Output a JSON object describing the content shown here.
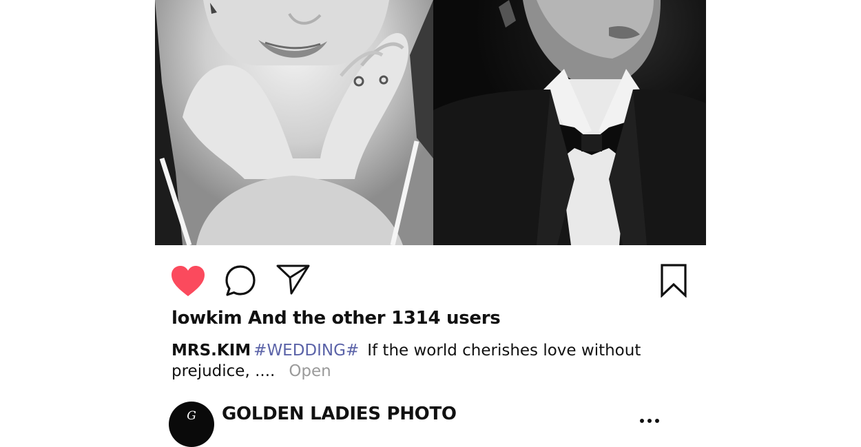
{
  "post": {
    "photos": [
      {
        "subject": "bride"
      },
      {
        "subject": "groom"
      }
    ],
    "actions": {
      "like_icon": "heart-icon",
      "liked": true,
      "like_color": "#fb4a5d",
      "comment_icon": "comment-bubble-icon",
      "share_icon": "send-paper-plane-icon",
      "save_icon": "bookmark-icon"
    },
    "likes_text": "lowkim And the other 1314 users",
    "caption": {
      "username": "MRS.KIM",
      "hashtag": "#WEDDING#",
      "text": "If the world cherishes love without prejudice, ....",
      "more_label": "Open"
    },
    "account": {
      "avatar_letter": "G",
      "name": "GOLDEN LADIES PHOTO",
      "menu_icon": "more-dots-icon"
    },
    "colors": {
      "hashtag": "#5b63a8",
      "more_link": "#9a9a9a",
      "text": "#111111"
    }
  }
}
